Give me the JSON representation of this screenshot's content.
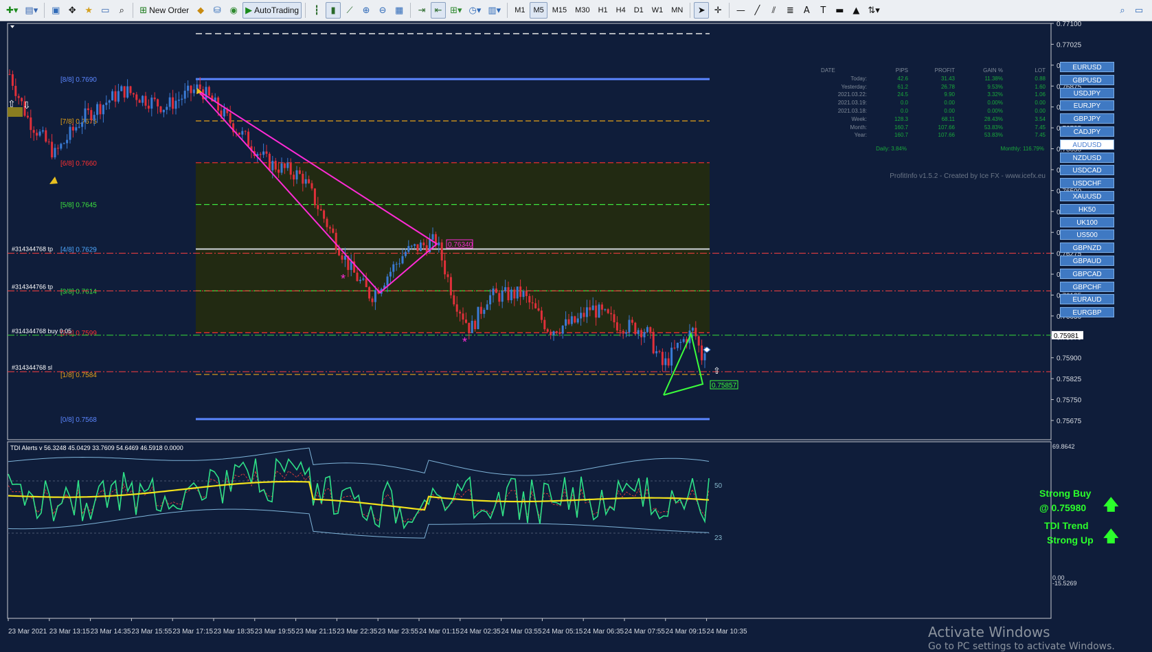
{
  "toolbar": {
    "new_order_label": "New Order",
    "autotrading_label": "AutoTrading",
    "timeframes": [
      "M1",
      "M5",
      "M15",
      "M30",
      "H1",
      "H4",
      "D1",
      "W1",
      "MN"
    ],
    "active_timeframe": "M5"
  },
  "price_axis": {
    "labels": [
      "0.77100",
      "0.77025",
      "0.76950",
      "0.76875",
      "0.76800",
      "0.76725",
      "0.76650",
      "0.76575",
      "0.76500",
      "0.76425",
      "0.76350",
      "0.76275",
      "0.76200",
      "0.76125",
      "0.76050",
      "0.75975",
      "0.75900",
      "0.75825",
      "0.75750",
      "0.75675"
    ],
    "current_price": "0.75981"
  },
  "murrey_levels": [
    {
      "label": "[8/8]",
      "value": "0.7690",
      "color": "#5b86ff"
    },
    {
      "label": "[7/8]",
      "value": "0.7675",
      "color": "#e8a317"
    },
    {
      "label": "[6/8]",
      "value": "0.7660",
      "color": "#ff3030"
    },
    {
      "label": "[5/8]",
      "value": "0.7645",
      "color": "#3ee63e"
    },
    {
      "label": "[4/8]",
      "value": "0.7629",
      "color": "#4ea8ff"
    },
    {
      "label": "[3/8]",
      "value": "0.7614",
      "color": "#3ee63e"
    },
    {
      "label": "[2/8]",
      "value": "0.7599",
      "color": "#ff3030"
    },
    {
      "label": "[1/8]",
      "value": "0.7584",
      "color": "#e8a317"
    },
    {
      "label": "[0/8]",
      "value": "0.7568",
      "color": "#5b86ff"
    }
  ],
  "order_labels": [
    "#314344768 tp",
    "#314344766 tp",
    "#314344768 buy 0.05",
    "#314344768 sl"
  ],
  "pattern_labels": {
    "upper": "0.76340",
    "lower": "0.75857"
  },
  "profit_info": {
    "headers": [
      "DATE",
      "PIPS",
      "PROFIT",
      "GAIN %",
      "LOT"
    ],
    "rows": [
      [
        "Today:",
        "42.6",
        "31.43",
        "11.38%",
        "0.88"
      ],
      [
        "Yesterday:",
        "61.2",
        "26.78",
        "9.53%",
        "1.60"
      ],
      [
        "2021.03.22:",
        "24.5",
        "9.90",
        "3.32%",
        "1.06"
      ],
      [
        "2021.03.19:",
        "0.0",
        "0.00",
        "0.00%",
        "0.00"
      ],
      [
        "2021.03.18:",
        "0.0",
        "0.00",
        "0.00%",
        "0.00"
      ],
      [
        "Week:",
        "128.3",
        "68.11",
        "28.43%",
        "3.54"
      ],
      [
        "Month:",
        "160.7",
        "107.66",
        "53.83%",
        "7.45"
      ],
      [
        "Year:",
        "160.7",
        "107.66",
        "53.83%",
        "7.45"
      ]
    ],
    "daily": "Daily: 3.84%",
    "monthly": "Monthly: 116.79%",
    "credit": "ProfitInfo v1.5.2 - Created by Ice FX - www.icefx.eu"
  },
  "symbols": [
    "EURUSD",
    "GBPUSD",
    "USDJPY",
    "EURJPY",
    "GBPJPY",
    "CADJPY",
    "AUDUSD",
    "NZDUSD",
    "USDCAD",
    "USDCHF",
    "XAUUSD",
    "HK50",
    "UK100",
    "US500",
    "GBPNZD",
    "GBPAUD",
    "GBPCAD",
    "GBPCHF",
    "EURAUD",
    "EURGBP"
  ],
  "active_symbol": "AUDUSD",
  "tdi": {
    "header": "TDI Alerts v 56.3248 45.0429 33.7609 54.6469 46.5918 0.0000",
    "level_50": "50",
    "level_23": "23",
    "scale_top": "69.8642",
    "scale_bottom_a": "0.00",
    "scale_bottom_b": "-15.5269",
    "signal1_line1": "Strong Buy",
    "signal1_line2": "@ 0.75980",
    "signal2_line1": "TDI Trend",
    "signal2_line2": "Strong Up"
  },
  "time_axis": [
    "23 Mar 2021",
    "23 Mar 13:15",
    "23 Mar 14:35",
    "23 Mar 15:55",
    "23 Mar 17:15",
    "23 Mar 18:35",
    "23 Mar 19:55",
    "23 Mar 21:15",
    "23 Mar 22:35",
    "23 Mar 23:55",
    "24 Mar 01:15",
    "24 Mar 02:35",
    "24 Mar 03:55",
    "24 Mar 05:15",
    "24 Mar 06:35",
    "24 Mar 07:55",
    "24 Mar 09:15",
    "24 Mar 10:35"
  ],
  "watermark": {
    "line1": "Activate Windows",
    "line2": "Go to PC settings to activate Windows."
  }
}
